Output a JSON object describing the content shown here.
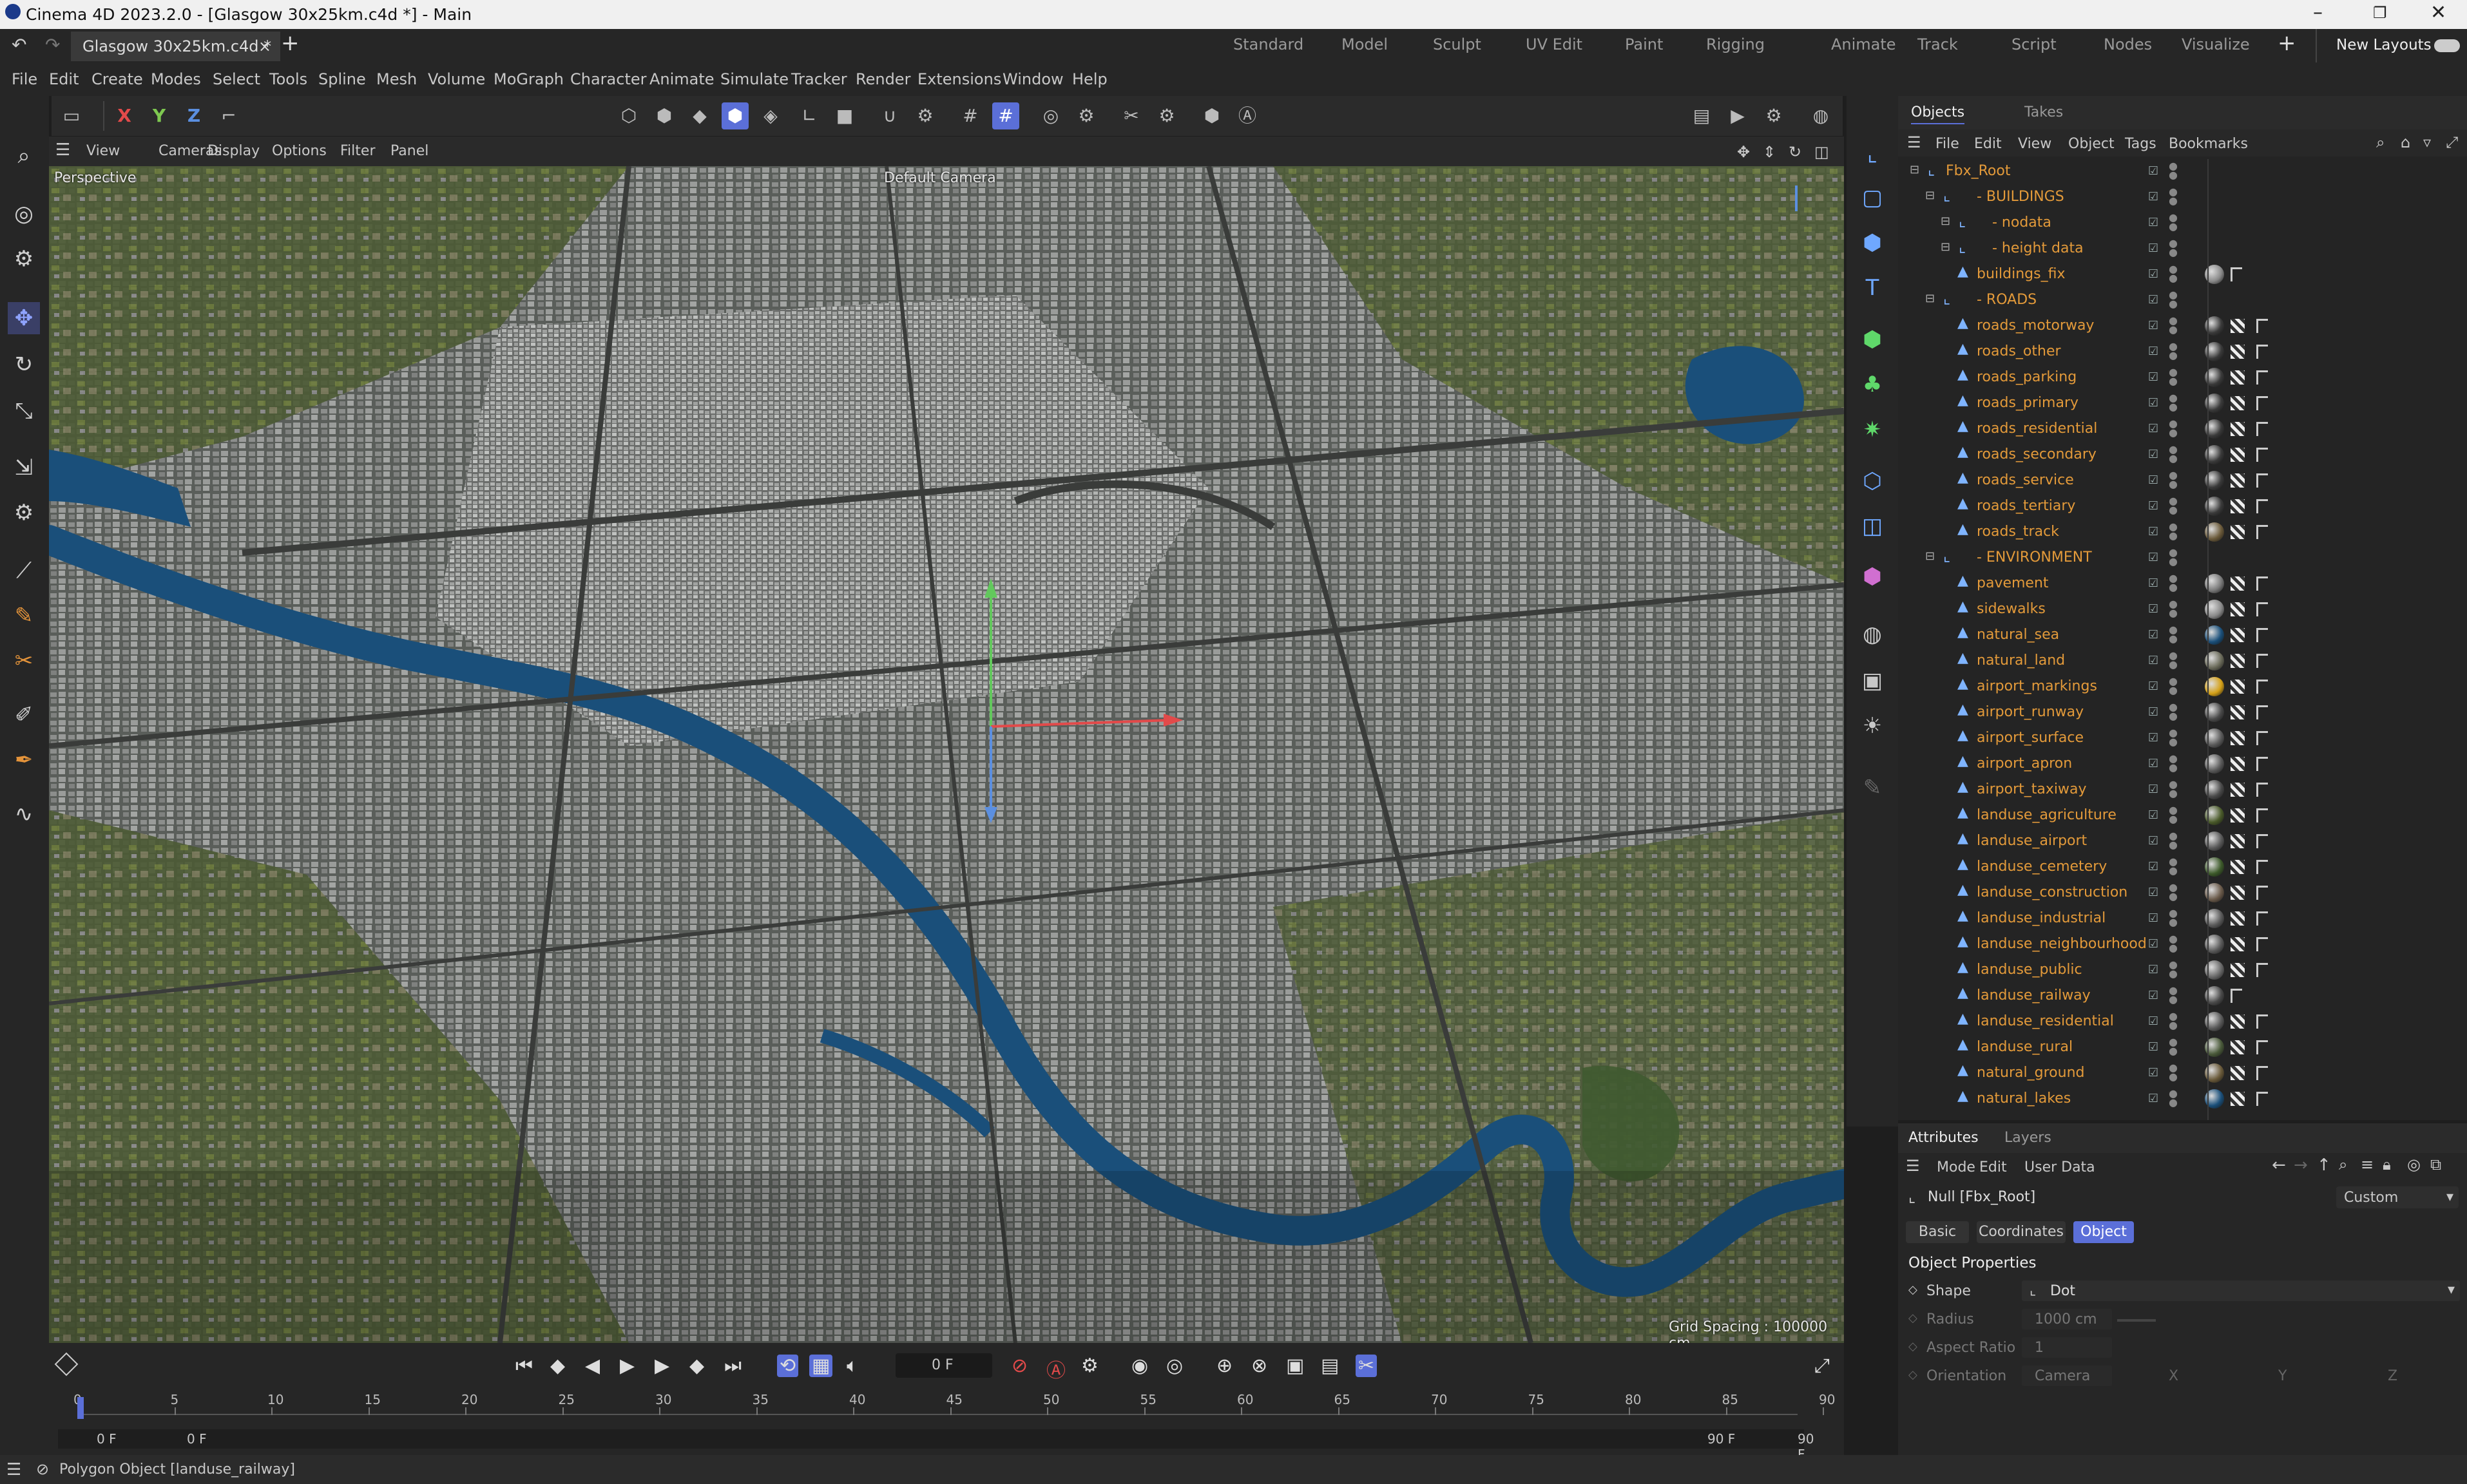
{
  "window": {
    "title": "Cinema 4D 2023.2.0 - [Glasgow 30x25km.c4d *] - Main",
    "minimize_icon": "minimize-icon",
    "maximize_icon": "maximize-icon",
    "close_icon": "close-icon"
  },
  "doc_tab": {
    "label": "Glasgow 30x25km.c4d *",
    "close": "×",
    "add": "+"
  },
  "layouts": [
    "Standard",
    "Model",
    "Sculpt",
    "UV Edit",
    "Paint",
    "Rigging",
    "Animate",
    "Track",
    "Script",
    "Nodes",
    "Visualize"
  ],
  "layouts_add": "+",
  "new_layouts": "New Layouts",
  "menu": [
    "File",
    "Edit",
    "Create",
    "Modes",
    "Select",
    "Tools",
    "Spline",
    "Mesh",
    "Volume",
    "MoGraph",
    "Character",
    "Animate",
    "Simulate",
    "Tracker",
    "Render",
    "Extensions",
    "Window",
    "Help"
  ],
  "axis_toggles": [
    "X",
    "Y",
    "Z"
  ],
  "viewport": {
    "menu": [
      "View",
      "Cameras",
      "Display",
      "Options",
      "Filter",
      "Panel"
    ],
    "projection": "Perspective",
    "camera": "Default Camera",
    "grid_spacing": "Grid Spacing : 100000 cm"
  },
  "objects": {
    "tabs": [
      "Objects",
      "Takes"
    ],
    "menu": [
      "File",
      "Edit",
      "View",
      "Object",
      "Tags",
      "Bookmarks"
    ],
    "tree": [
      {
        "label": "Fbx_Root",
        "indent": 0,
        "kind": "null",
        "tags": []
      },
      {
        "label": "BUILDINGS",
        "indent": 1,
        "kind": "null",
        "tags": []
      },
      {
        "label": "nodata",
        "indent": 2,
        "kind": "null",
        "tags": []
      },
      {
        "label": "height data",
        "indent": 2,
        "kind": "null",
        "tags": []
      },
      {
        "label": "buildings_fix",
        "indent": 2,
        "kind": "poly",
        "tags": [
          "#8a8a8a",
          "",
          "f"
        ]
      },
      {
        "label": "ROADS",
        "indent": 1,
        "kind": "null",
        "tags": []
      },
      {
        "label": "roads_motorway",
        "indent": 2,
        "kind": "poly",
        "tags": [
          "#3a3a3a",
          "b",
          "f"
        ]
      },
      {
        "label": "roads_other",
        "indent": 2,
        "kind": "poly",
        "tags": [
          "#3a3a3a",
          "b",
          "f"
        ]
      },
      {
        "label": "roads_parking",
        "indent": 2,
        "kind": "poly",
        "tags": [
          "#3a3a3a",
          "b",
          "f"
        ]
      },
      {
        "label": "roads_primary",
        "indent": 2,
        "kind": "poly",
        "tags": [
          "#3a3a3a",
          "b",
          "f"
        ]
      },
      {
        "label": "roads_residential",
        "indent": 2,
        "kind": "poly",
        "tags": [
          "#3a3a3a",
          "b",
          "f"
        ]
      },
      {
        "label": "roads_secondary",
        "indent": 2,
        "kind": "poly",
        "tags": [
          "#3a3a3a",
          "b",
          "f"
        ]
      },
      {
        "label": "roads_service",
        "indent": 2,
        "kind": "poly",
        "tags": [
          "#3a3a3a",
          "b",
          "f"
        ]
      },
      {
        "label": "roads_tertiary",
        "indent": 2,
        "kind": "poly",
        "tags": [
          "#3a3a3a",
          "b",
          "f"
        ]
      },
      {
        "label": "roads_track",
        "indent": 2,
        "kind": "poly",
        "tags": [
          "#6b5a3a",
          "b",
          "f"
        ]
      },
      {
        "label": "ENVIRONMENT",
        "indent": 1,
        "kind": "null",
        "tags": []
      },
      {
        "label": "pavement",
        "indent": 2,
        "kind": "poly",
        "tags": [
          "#7a7a7a",
          "b",
          "f"
        ]
      },
      {
        "label": "sidewalks",
        "indent": 2,
        "kind": "poly",
        "tags": [
          "#8a8a8a",
          "b",
          "f"
        ]
      },
      {
        "label": "natural_sea",
        "indent": 2,
        "kind": "poly",
        "tags": [
          "#1a4f7a",
          "b",
          "f"
        ]
      },
      {
        "label": "natural_land",
        "indent": 2,
        "kind": "poly",
        "tags": [
          "#6b6b5a",
          "b",
          "f"
        ]
      },
      {
        "label": "airport_markings",
        "indent": 2,
        "kind": "poly",
        "tags": [
          "#d4a017",
          "b",
          "f"
        ]
      },
      {
        "label": "airport_runway",
        "indent": 2,
        "kind": "poly",
        "tags": [
          "#4a4a4a",
          "b",
          "f"
        ]
      },
      {
        "label": "airport_surface",
        "indent": 2,
        "kind": "poly",
        "tags": [
          "#5a5a5a",
          "b",
          "f"
        ]
      },
      {
        "label": "airport_apron",
        "indent": 2,
        "kind": "poly",
        "tags": [
          "#5a5a5a",
          "b",
          "f"
        ]
      },
      {
        "label": "airport_taxiway",
        "indent": 2,
        "kind": "poly",
        "tags": [
          "#4a4a4a",
          "b",
          "f"
        ]
      },
      {
        "label": "landuse_agriculture",
        "indent": 2,
        "kind": "poly",
        "tags": [
          "#4a5a2a",
          "b",
          "f"
        ]
      },
      {
        "label": "landuse_airport",
        "indent": 2,
        "kind": "poly",
        "tags": [
          "#5a5a5a",
          "b",
          "f"
        ]
      },
      {
        "label": "landuse_cemetery",
        "indent": 2,
        "kind": "poly",
        "tags": [
          "#3d5a2a",
          "b",
          "f"
        ]
      },
      {
        "label": "landuse_construction",
        "indent": 2,
        "kind": "poly",
        "tags": [
          "#6a5a4a",
          "b",
          "f"
        ]
      },
      {
        "label": "landuse_industrial",
        "indent": 2,
        "kind": "poly",
        "tags": [
          "#5a5a5a",
          "b",
          "f"
        ]
      },
      {
        "label": "landuse_neighbourhood",
        "indent": 2,
        "kind": "poly",
        "tags": [
          "#5a5a5a",
          "b",
          "f"
        ]
      },
      {
        "label": "landuse_public",
        "indent": 2,
        "kind": "poly",
        "tags": [
          "#6a6a6a",
          "b",
          "f"
        ]
      },
      {
        "label": "landuse_railway",
        "indent": 2,
        "kind": "poly",
        "tags": [
          "#4a4a4a",
          "",
          "f"
        ]
      },
      {
        "label": "landuse_residential",
        "indent": 2,
        "kind": "poly",
        "tags": [
          "#5a5a5a",
          "b",
          "f"
        ]
      },
      {
        "label": "landuse_rural",
        "indent": 2,
        "kind": "poly",
        "tags": [
          "#4a5a3a",
          "b",
          "f"
        ]
      },
      {
        "label": "natural_ground",
        "indent": 2,
        "kind": "poly",
        "tags": [
          "#6a5a3a",
          "b",
          "f"
        ]
      },
      {
        "label": "natural_lakes",
        "indent": 2,
        "kind": "poly",
        "tags": [
          "#1a4f7a",
          "b",
          "f"
        ]
      }
    ]
  },
  "attributes": {
    "tabs": [
      "Attributes",
      "Layers"
    ],
    "menu": [
      "Mode",
      "Edit",
      "User Data"
    ],
    "object_name": "Null [Fbx_Root]",
    "preset": "Custom",
    "subtabs": [
      "Basic",
      "Coordinates",
      "Object"
    ],
    "active_subtab": "Object",
    "section": "Object Properties",
    "props": [
      {
        "label": "Shape",
        "value": "Dot"
      },
      {
        "label": "Radius",
        "value": "1000 cm"
      },
      {
        "label": "Aspect Ratio",
        "value": "1"
      },
      {
        "label": "Orientation",
        "value": "Camera"
      }
    ],
    "orientation_axes": [
      "X",
      "Y",
      "Z"
    ]
  },
  "timeline": {
    "current_frame": "0 F",
    "ticks": [
      "0",
      "5",
      "10",
      "15",
      "20",
      "25",
      "30",
      "35",
      "40",
      "45",
      "50",
      "55",
      "60",
      "65",
      "70",
      "75",
      "80",
      "85",
      "90"
    ],
    "start": "0 F",
    "range_start": "0 F",
    "range_end": "90 F",
    "end": "90 F"
  },
  "status": {
    "text": "Polygon Object [landuse_railway]"
  },
  "colors": {
    "accent": "#5b6fd8",
    "object_label": "#e39a3a",
    "water": "#1a4f7a"
  }
}
